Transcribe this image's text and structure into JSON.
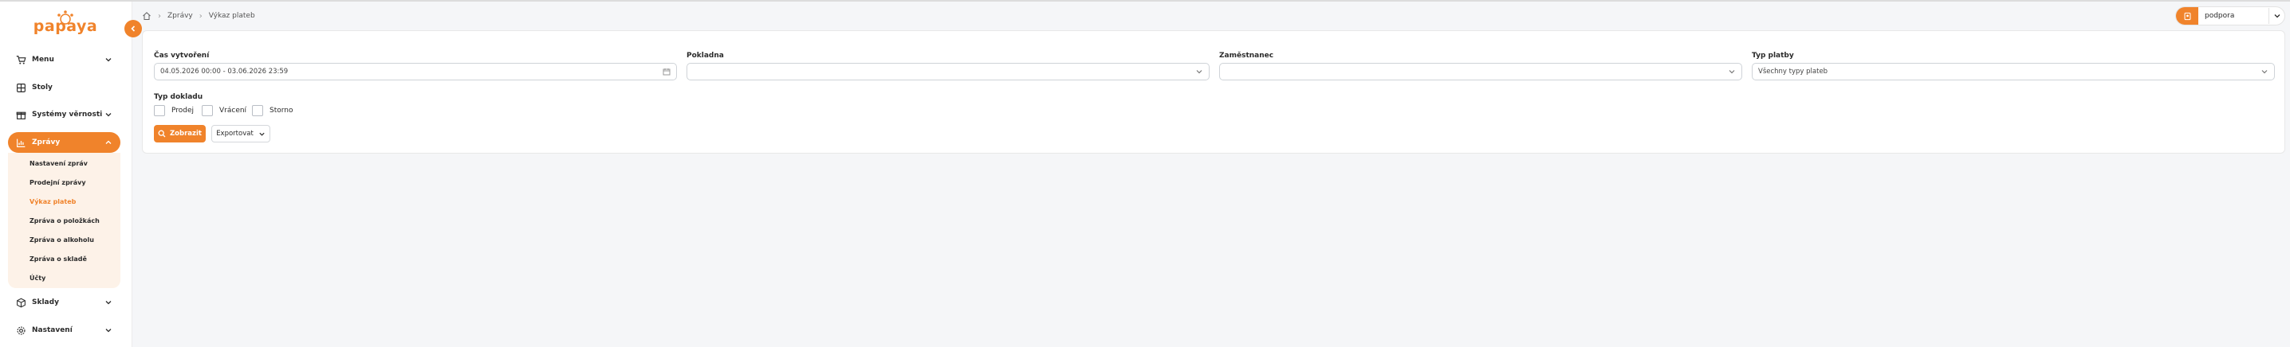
{
  "brand": {
    "logo_text": "papaya",
    "accent_color": "#f0832b"
  },
  "sidebar": {
    "items": [
      {
        "label": "Menu",
        "icon": "cart-icon"
      },
      {
        "label": "Stoly",
        "icon": "table-icon"
      },
      {
        "label": "Systémy věrnosti",
        "icon": "gift-icon"
      },
      {
        "label": "Zprávy",
        "icon": "chart-icon",
        "active": true
      },
      {
        "label": "Sklady",
        "icon": "box-icon"
      },
      {
        "label": "Nastavení",
        "icon": "gear-icon"
      }
    ],
    "submenu": [
      {
        "label": "Nastavení zpráv"
      },
      {
        "label": "Prodejní zprávy"
      },
      {
        "label": "Výkaz plateb",
        "current": true
      },
      {
        "label": "Zpráva o položkách"
      },
      {
        "label": "Zpráva o alkoholu"
      },
      {
        "label": "Zpráva o skladě"
      },
      {
        "label": "Účty"
      }
    ]
  },
  "breadcrumb": {
    "items": [
      "Zprávy",
      "Výkaz plateb"
    ]
  },
  "user": {
    "name": "podpora"
  },
  "filters": {
    "created_label": "Čas vytvoření",
    "created_value": "04.05.2026 00:00 - 03.06.2026 23:59",
    "register_label": "Pokladna",
    "register_value": "",
    "employee_label": "Zaměstnanec",
    "employee_value": "",
    "payment_type_label": "Typ platby",
    "payment_type_value": "Všechny typy plateb",
    "doc_type_label": "Typ dokladu",
    "doc_types": [
      "Prodej",
      "Vrácení",
      "Storno"
    ]
  },
  "actions": {
    "show_label": "Zobrazit",
    "export_label": "Exportovat"
  }
}
